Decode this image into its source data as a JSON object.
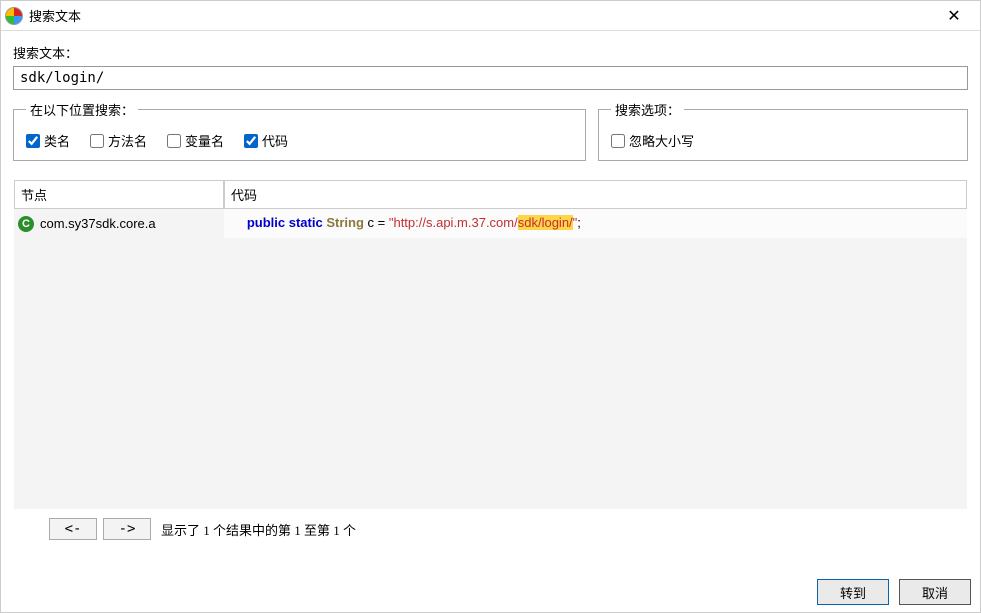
{
  "window": {
    "title": "搜索文本"
  },
  "search": {
    "label": "搜索文本：",
    "value": "sdk/login/"
  },
  "groups": {
    "locations": {
      "legend": "在以下位置搜索：",
      "options": [
        {
          "label": "类名",
          "checked": true
        },
        {
          "label": "方法名",
          "checked": false
        },
        {
          "label": "变量名",
          "checked": false
        },
        {
          "label": "代码",
          "checked": true
        }
      ]
    },
    "options": {
      "legend": "搜索选项：",
      "items": [
        {
          "label": "忽略大小写",
          "checked": false
        }
      ]
    }
  },
  "results": {
    "headers": {
      "node": "节点",
      "code": "代码"
    },
    "rows": [
      {
        "node": "com.sy37sdk.core.a",
        "code_tokens": [
          {
            "t": "   ",
            "c": ""
          },
          {
            "t": "public",
            "c": "kw"
          },
          {
            "t": " ",
            "c": ""
          },
          {
            "t": "static",
            "c": "kw"
          },
          {
            "t": " ",
            "c": ""
          },
          {
            "t": "String",
            "c": "ty"
          },
          {
            "t": " c = ",
            "c": ""
          },
          {
            "t": "\"http://s.api.m.37.com/",
            "c": "str"
          },
          {
            "t": "sdk/login/",
            "c": "str hl"
          },
          {
            "t": "\"",
            "c": "str"
          },
          {
            "t": ";",
            "c": ""
          }
        ]
      }
    ]
  },
  "nav": {
    "prev": "<-",
    "next": "->",
    "status": "显示了 1 个结果中的第 1 至第 1 个"
  },
  "buttons": {
    "go": "转到",
    "cancel": "取消"
  }
}
